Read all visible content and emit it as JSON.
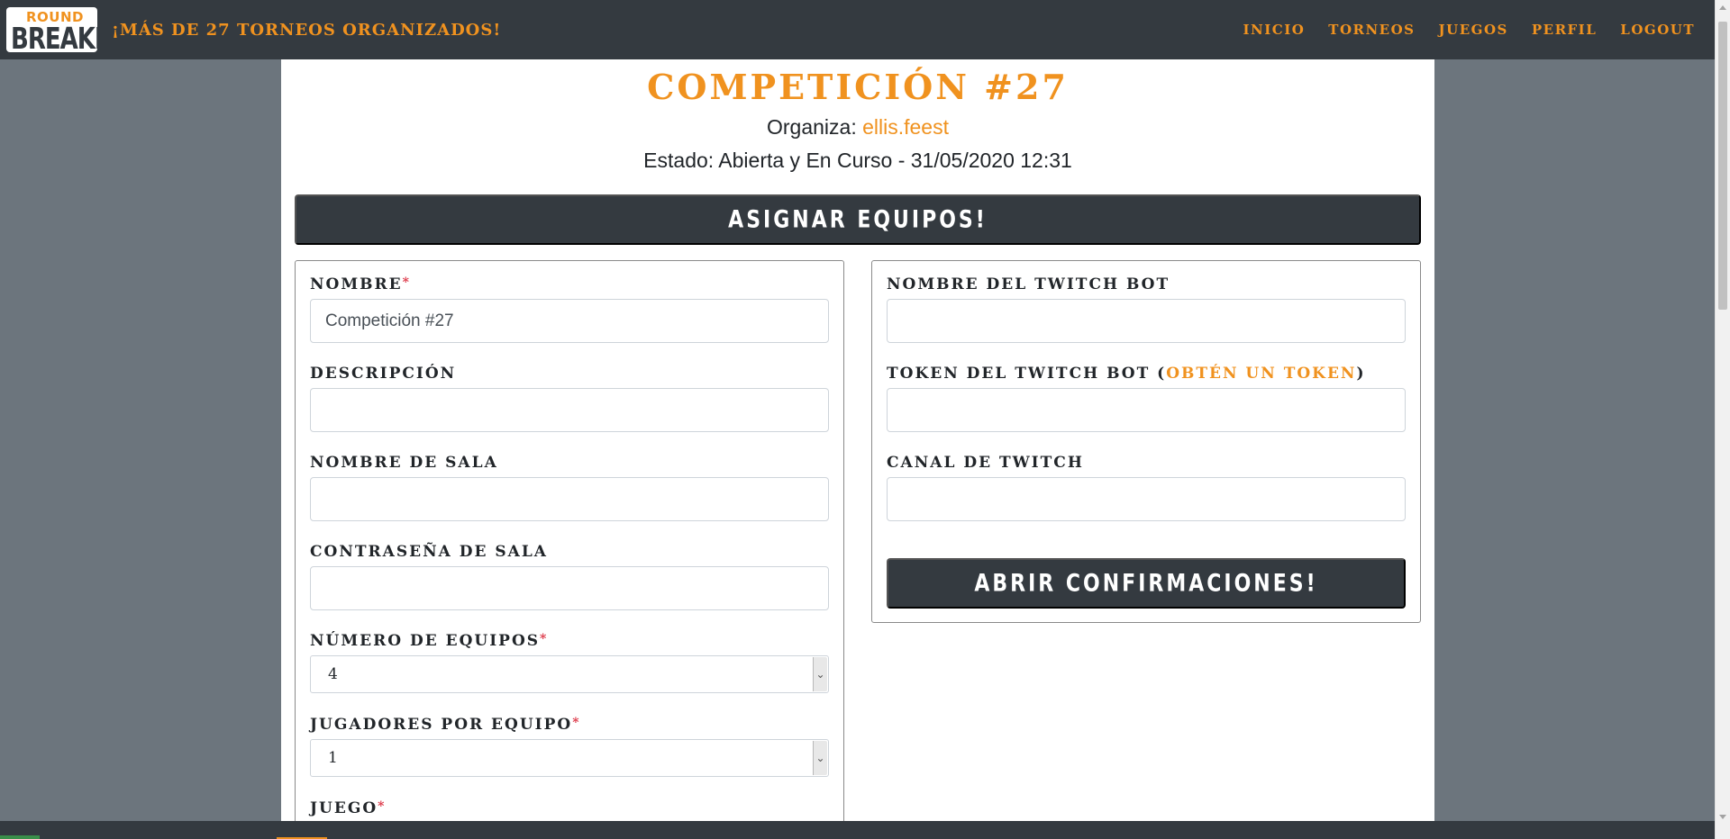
{
  "navbar": {
    "logo_top": "ROUND",
    "logo_bottom": "BREAKER",
    "tagline": "¡MÁS DE 27 TORNEOS ORGANIZADOS!",
    "links": [
      "INICIO",
      "TORNEOS",
      "JUEGOS",
      "PERFIL",
      "LOGOUT"
    ]
  },
  "header": {
    "title": "COMPETICIÓN #27",
    "organizer_label": "Organiza:",
    "organizer_name": "ellis.feest",
    "state_text": "Estado: Abierta y En Curso - 31/05/2020 12:31"
  },
  "assign_button": "ASIGNAR EQUIPOS!",
  "left_form": {
    "nombre_label": "NOMBRE",
    "nombre_value": "Competición #27",
    "descripcion_label": "DESCRIPCIÓN",
    "descripcion_value": "",
    "sala_label": "NOMBRE DE SALA",
    "sala_value": "",
    "password_label": "CONTRASEÑA DE SALA",
    "password_value": "",
    "equipos_label": "NÚMERO DE EQUIPOS",
    "equipos_value": "4",
    "jugadores_label": "JUGADORES POR EQUIPO",
    "jugadores_value": "1",
    "juego_label": "JUEGO"
  },
  "right_form": {
    "bot_name_label": "NOMBRE DEL TWITCH BOT",
    "bot_name_value": "",
    "bot_token_label": "TOKEN DEL TWITCH BOT (",
    "bot_token_link": "OBTÉN UN TOKEN",
    "bot_token_close": ")",
    "bot_token_value": "",
    "channel_label": "CANAL DE TWITCH",
    "channel_value": "",
    "open_button": "ABRIR CONFIRMACIONES!"
  },
  "required_mark": "*",
  "colors": {
    "accent": "#f0921f",
    "dark": "#343a40",
    "background": "#6c757d",
    "required": "#dc3545"
  }
}
